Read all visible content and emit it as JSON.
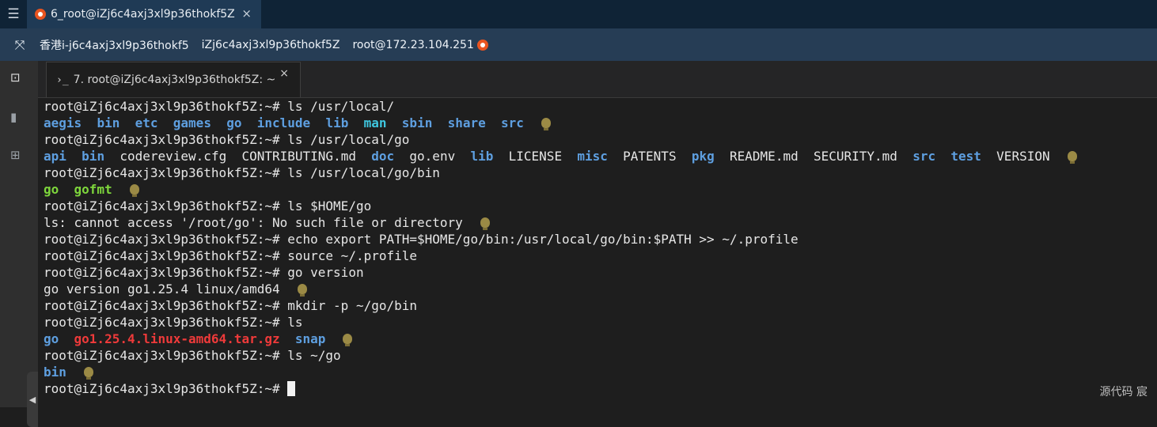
{
  "window_tab": {
    "title": "6_root@iZj6c4axj3xl9p36thokf5Z",
    "close": "×"
  },
  "infobar": {
    "region": "香港i-j6c4axj3xl9p36thokf5",
    "hostname": "iZj6c4axj3xl9p36thokf5Z",
    "user_ip": "root@172.23.104.251"
  },
  "terminal_tab": {
    "icon": "›_",
    "title": "7. root@iZj6c4axj3xl9p36thokf5Z: ~",
    "close": "×"
  },
  "sidebar_icons": [
    "terminal-icon",
    "file-icon",
    "apps-icon"
  ],
  "colors": {
    "directory": "#5e9fe0",
    "executable": "#7ed63c",
    "archive": "#ef3a3a",
    "prompt_text": "#e6e6e6",
    "title_bg": "#0f2336",
    "info_bg": "#263d55"
  },
  "terminal": {
    "lines": [
      {
        "segs": [
          {
            "t": "root@iZj6c4axj3xl9p36thokf5Z:~# ls /usr/local/",
            "c": "plain"
          }
        ],
        "bulb": false
      },
      {
        "segs": [
          {
            "t": "aegis",
            "c": "dir"
          },
          {
            "t": "  ",
            "c": "plain"
          },
          {
            "t": "bin",
            "c": "dir"
          },
          {
            "t": "  ",
            "c": "plain"
          },
          {
            "t": "etc",
            "c": "dir"
          },
          {
            "t": "  ",
            "c": "plain"
          },
          {
            "t": "games",
            "c": "dir"
          },
          {
            "t": "  ",
            "c": "plain"
          },
          {
            "t": "go",
            "c": "dir"
          },
          {
            "t": "  ",
            "c": "plain"
          },
          {
            "t": "include",
            "c": "dir"
          },
          {
            "t": "  ",
            "c": "plain"
          },
          {
            "t": "lib",
            "c": "dir"
          },
          {
            "t": "  ",
            "c": "plain"
          },
          {
            "t": "man",
            "c": "dirc"
          },
          {
            "t": "  ",
            "c": "plain"
          },
          {
            "t": "sbin",
            "c": "dir"
          },
          {
            "t": "  ",
            "c": "plain"
          },
          {
            "t": "share",
            "c": "dir"
          },
          {
            "t": "  ",
            "c": "plain"
          },
          {
            "t": "src",
            "c": "dir"
          }
        ],
        "bulb": true
      },
      {
        "segs": [
          {
            "t": "root@iZj6c4axj3xl9p36thokf5Z:~# ls /usr/local/go",
            "c": "plain"
          }
        ],
        "bulb": false
      },
      {
        "segs": [
          {
            "t": "api",
            "c": "dir"
          },
          {
            "t": "  ",
            "c": "plain"
          },
          {
            "t": "bin",
            "c": "dir"
          },
          {
            "t": "  codereview.cfg  CONTRIBUTING.md  ",
            "c": "plain"
          },
          {
            "t": "doc",
            "c": "dir"
          },
          {
            "t": "  go.env  ",
            "c": "plain"
          },
          {
            "t": "lib",
            "c": "dir"
          },
          {
            "t": "  LICENSE  ",
            "c": "plain"
          },
          {
            "t": "misc",
            "c": "dir"
          },
          {
            "t": "  PATENTS  ",
            "c": "plain"
          },
          {
            "t": "pkg",
            "c": "dir"
          },
          {
            "t": "  README.md  SECURITY.md  ",
            "c": "plain"
          },
          {
            "t": "src",
            "c": "dir"
          },
          {
            "t": "  ",
            "c": "plain"
          },
          {
            "t": "test",
            "c": "dir"
          },
          {
            "t": "  VERSION",
            "c": "plain"
          }
        ],
        "bulb": true
      },
      {
        "segs": [
          {
            "t": "root@iZj6c4axj3xl9p36thokf5Z:~# ls /usr/local/go/bin",
            "c": "plain"
          }
        ],
        "bulb": false
      },
      {
        "segs": [
          {
            "t": "go",
            "c": "exe"
          },
          {
            "t": "  ",
            "c": "plain"
          },
          {
            "t": "gofmt",
            "c": "exe"
          }
        ],
        "bulb": true
      },
      {
        "segs": [
          {
            "t": "root@iZj6c4axj3xl9p36thokf5Z:~# ls $HOME/go",
            "c": "plain"
          }
        ],
        "bulb": false
      },
      {
        "segs": [
          {
            "t": "ls: cannot access '/root/go': No such file or directory",
            "c": "plain"
          }
        ],
        "bulb": true
      },
      {
        "segs": [
          {
            "t": "root@iZj6c4axj3xl9p36thokf5Z:~# echo export PATH=$HOME/go/bin:/usr/local/go/bin:$PATH >> ~/.profile",
            "c": "plain"
          }
        ],
        "bulb": false
      },
      {
        "segs": [
          {
            "t": "root@iZj6c4axj3xl9p36thokf5Z:~# source ~/.profile",
            "c": "plain"
          }
        ],
        "bulb": false
      },
      {
        "segs": [
          {
            "t": "root@iZj6c4axj3xl9p36thokf5Z:~# go version",
            "c": "plain"
          }
        ],
        "bulb": false
      },
      {
        "segs": [
          {
            "t": "go version go1.25.4 linux/amd64",
            "c": "plain"
          }
        ],
        "bulb": true
      },
      {
        "segs": [
          {
            "t": "root@iZj6c4axj3xl9p36thokf5Z:~# mkdir -p ~/go/bin",
            "c": "plain"
          }
        ],
        "bulb": false
      },
      {
        "segs": [
          {
            "t": "root@iZj6c4axj3xl9p36thokf5Z:~# ls",
            "c": "plain"
          }
        ],
        "bulb": false
      },
      {
        "segs": [
          {
            "t": "go",
            "c": "dir"
          },
          {
            "t": "  ",
            "c": "plain"
          },
          {
            "t": "go1.25.4.linux-amd64.tar.gz",
            "c": "arc"
          },
          {
            "t": "  ",
            "c": "plain"
          },
          {
            "t": "snap",
            "c": "dir"
          }
        ],
        "bulb": true
      },
      {
        "segs": [
          {
            "t": "root@iZj6c4axj3xl9p36thokf5Z:~# ls ~/go",
            "c": "plain"
          }
        ],
        "bulb": false
      },
      {
        "segs": [
          {
            "t": "bin",
            "c": "dir"
          }
        ],
        "bulb": true
      },
      {
        "segs": [
          {
            "t": "root@iZj6c4axj3xl9p36thokf5Z:~# ",
            "c": "plain"
          }
        ],
        "bulb": false,
        "cursor": true
      }
    ]
  },
  "watermark": "源代码  宸"
}
